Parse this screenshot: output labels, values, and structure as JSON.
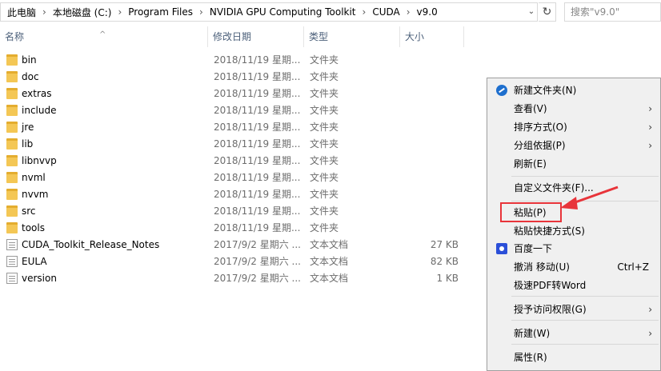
{
  "address_bar": {
    "crumbs": [
      "此电脑",
      "本地磁盘 (C:)",
      "Program Files",
      "NVIDIA GPU Computing Toolkit",
      "CUDA",
      "v9.0"
    ],
    "separator": "›",
    "dropdown_glyph": "⌄",
    "refresh_glyph": "↻",
    "search_placeholder": "搜索\"v9.0\""
  },
  "columns": {
    "name": "名称",
    "date": "修改日期",
    "type": "类型",
    "size": "大小",
    "sort_glyph": "^"
  },
  "files": [
    {
      "name": "bin",
      "date": "2018/11/19 星期...",
      "type": "文件夹",
      "size": "",
      "kind": "folder"
    },
    {
      "name": "doc",
      "date": "2018/11/19 星期...",
      "type": "文件夹",
      "size": "",
      "kind": "folder"
    },
    {
      "name": "extras",
      "date": "2018/11/19 星期...",
      "type": "文件夹",
      "size": "",
      "kind": "folder"
    },
    {
      "name": "include",
      "date": "2018/11/19 星期...",
      "type": "文件夹",
      "size": "",
      "kind": "folder"
    },
    {
      "name": "jre",
      "date": "2018/11/19 星期...",
      "type": "文件夹",
      "size": "",
      "kind": "folder"
    },
    {
      "name": "lib",
      "date": "2018/11/19 星期...",
      "type": "文件夹",
      "size": "",
      "kind": "folder"
    },
    {
      "name": "libnvvp",
      "date": "2018/11/19 星期...",
      "type": "文件夹",
      "size": "",
      "kind": "folder"
    },
    {
      "name": "nvml",
      "date": "2018/11/19 星期...",
      "type": "文件夹",
      "size": "",
      "kind": "folder"
    },
    {
      "name": "nvvm",
      "date": "2018/11/19 星期...",
      "type": "文件夹",
      "size": "",
      "kind": "folder"
    },
    {
      "name": "src",
      "date": "2018/11/19 星期...",
      "type": "文件夹",
      "size": "",
      "kind": "folder"
    },
    {
      "name": "tools",
      "date": "2018/11/19 星期...",
      "type": "文件夹",
      "size": "",
      "kind": "folder"
    },
    {
      "name": "CUDA_Toolkit_Release_Notes",
      "date": "2017/9/2 星期六 ...",
      "type": "文本文档",
      "size": "27 KB",
      "kind": "document"
    },
    {
      "name": "EULA",
      "date": "2017/9/2 星期六 ...",
      "type": "文本文档",
      "size": "82 KB",
      "kind": "document"
    },
    {
      "name": "version",
      "date": "2017/9/2 星期六 ...",
      "type": "文本文档",
      "size": "1 KB",
      "kind": "document"
    }
  ],
  "context_menu": {
    "items": [
      {
        "label": "新建文件夹(N)",
        "icon": "new-folder-icon"
      },
      {
        "label": "查看(V)",
        "submenu": true
      },
      {
        "label": "排序方式(O)",
        "submenu": true
      },
      {
        "label": "分组依据(P)",
        "submenu": true
      },
      {
        "label": "刷新(E)"
      },
      {
        "label": "自定义文件夹(F)..."
      },
      {
        "label": "粘贴(P)",
        "highlighted": true
      },
      {
        "label": "粘贴快捷方式(S)"
      },
      {
        "label": "百度一下",
        "icon": "baidu-icon"
      },
      {
        "label": "撤消 移动(U)",
        "shortcut": "Ctrl+Z"
      },
      {
        "label": "极速PDF转Word"
      },
      {
        "label": "授予访问权限(G)",
        "submenu": true
      },
      {
        "label": "新建(W)",
        "submenu": true
      },
      {
        "label": "属性(R)"
      }
    ],
    "submenu_glyph": "›"
  },
  "colors": {
    "highlight": "#e8343a",
    "folder": "#f4c755",
    "header_text": "#4c607a"
  }
}
